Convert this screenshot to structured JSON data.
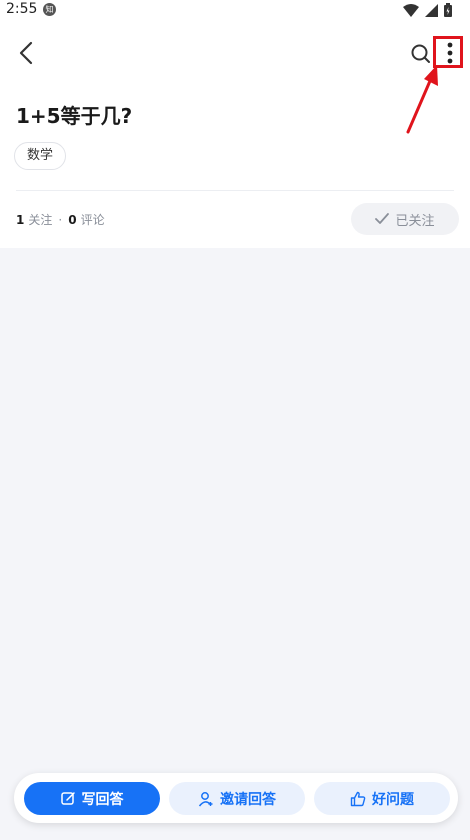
{
  "status_bar": {
    "time": "2:55",
    "app_badge": "知"
  },
  "question": {
    "title": "1+5等于几?",
    "tag": "数学",
    "follow_count": "1",
    "follow_label": "关注",
    "separator": "·",
    "comment_count": "0",
    "comment_label": "评论",
    "followed_button": "已关注"
  },
  "actions": {
    "write_answer": "写回答",
    "invite_answer": "邀请回答",
    "good_question": "好问题"
  },
  "colors": {
    "accent": "#1772f6",
    "highlight": "#e0141c"
  }
}
